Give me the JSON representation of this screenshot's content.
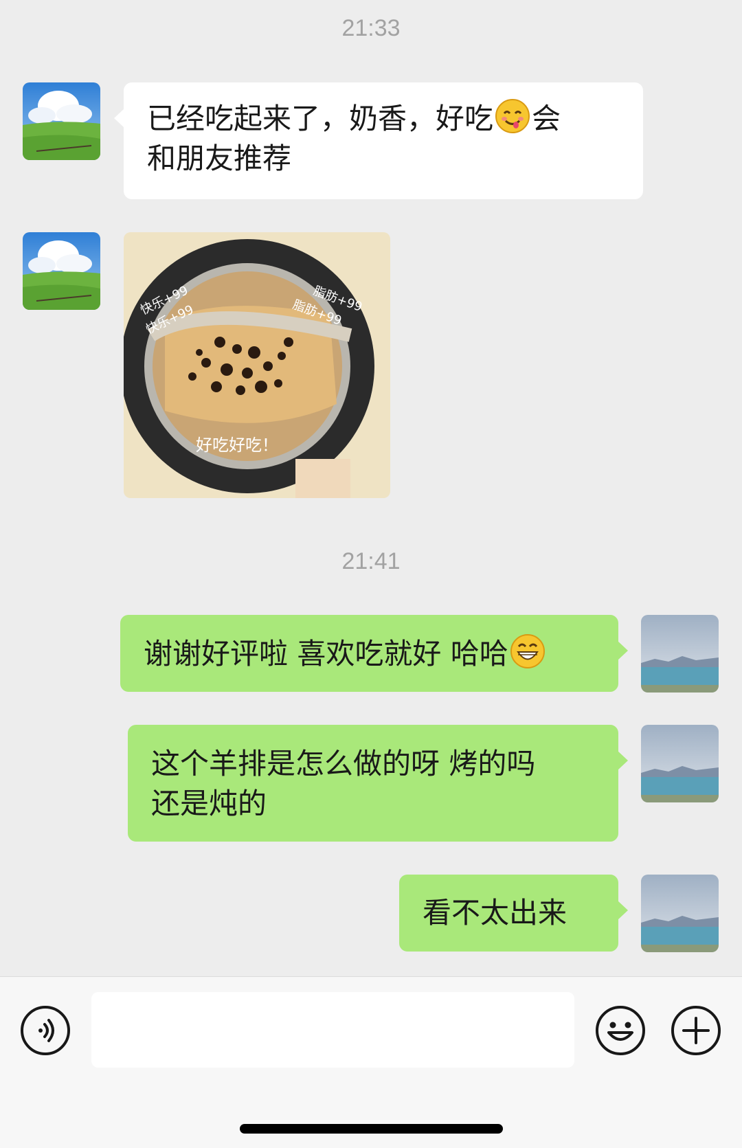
{
  "timestamps": [
    "21:33",
    "21:41"
  ],
  "messages": [
    {
      "side": "in",
      "text_line1": "已经吃起来了，奶香，好吃",
      "emoji": "yum-emoji",
      "text_line1_tail": "会",
      "text_line2": "和朋友推荐"
    },
    {
      "side": "in",
      "type": "image",
      "overlay_texts": [
        "快乐+99",
        "快乐+99",
        "脂肪+99",
        "脂肪+99",
        "好吃好吃！"
      ]
    },
    {
      "side": "out",
      "text": "谢谢好评啦 喜欢吃就好 哈哈",
      "emoji": "grin-emoji"
    },
    {
      "side": "out",
      "text_line1": "这个羊排是怎么做的呀 烤的吗",
      "text_line2": "还是炖的"
    },
    {
      "side": "out",
      "text": "看不太出来"
    }
  ],
  "input_bar": {
    "voice_icon": "voice-icon",
    "emoji_icon": "emoji-icon",
    "plus_icon": "plus-icon",
    "input_value": ""
  },
  "colors": {
    "background": "#ededed",
    "incoming_bubble": "#ffffff",
    "outgoing_bubble": "#a9e87a",
    "timestamp": "#a2a2a2"
  }
}
